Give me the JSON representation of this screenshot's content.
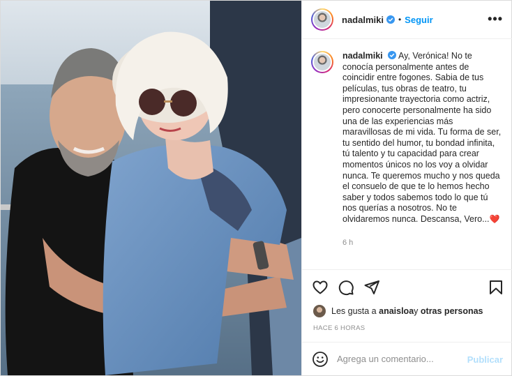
{
  "post": {
    "username": "nadalmiki",
    "follow_label": "Seguir",
    "dot": "•",
    "more_label": "•••",
    "caption_user": "nadalmiki",
    "caption_text": "Ay, Verónica! No te conocía personalmente antes de coincidir entre fogones. Sabia de tus películas, tus obras de teatro, tu impresionante trayectoria como actriz, pero conocerte personalmente ha sido una de las experiencias más maravillosas de mi vida. Tu forma de ser, tu sentido del humor, tu bondad infinita, tú talento y tu capacidad para crear momentos únicos no los voy a olvidar nunca. Te queremos mucho y nos queda el consuelo de que te lo hemos hecho saber y todos sabemos todo lo que tú nos querías a nosotros. No te olvidaremos nunca. Descansa, Vero...",
    "heart_emoji": "❤️",
    "caption_time": "6 h",
    "likes_prefix": "Les gusta a ",
    "likes_user": "anaisloa",
    "likes_suffix": " y ",
    "likes_others": "otras personas",
    "time_upper": "HACE 6 HORAS",
    "comment_placeholder": "Agrega un comentario...",
    "publish_label": "Publicar"
  },
  "icons": {
    "verified": "verified-badge-icon",
    "like": "heart-outline-icon",
    "comment": "comment-bubble-icon",
    "share": "paper-plane-icon",
    "save": "bookmark-icon",
    "emoji": "smiley-face-icon",
    "more": "more-options-icon"
  },
  "colors": {
    "follow": "#0095f6",
    "publish_disabled": "#b2dffc",
    "verified": "#3897f0",
    "heart": "#e0245e",
    "secondary_text": "#8e8e8e"
  }
}
